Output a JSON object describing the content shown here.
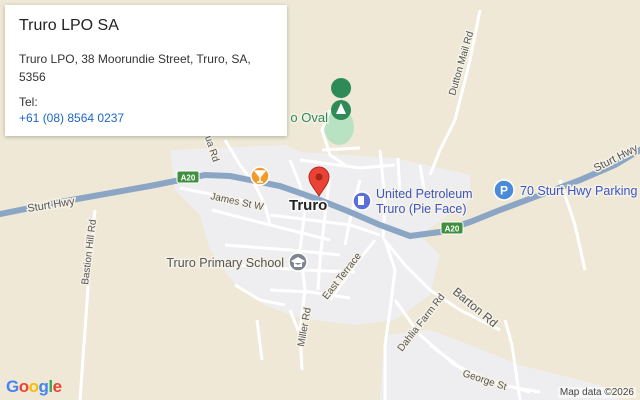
{
  "info_card": {
    "title": "Truro LPO SA",
    "address": "Truro LPO, 38 Moorundie Street, Truro, SA, 5356",
    "tel_label": "Tel:",
    "tel_value": "+61 (08) 8564 0237"
  },
  "map": {
    "town": "Truro",
    "pois": {
      "oval": "o Oval",
      "petrol_line1": "United Petroleum",
      "petrol_line2": "Truro (Pie Face)",
      "parking": "70 Sturt Hwy Parking",
      "parking_badge": "P",
      "school": "Truro Primary School"
    },
    "roads": {
      "sturt_west": "Sturt Hwy",
      "sturt_east": "Sturt Hwy",
      "james": "James St W",
      "bastion": "Bastion Hill Rd",
      "dutton": "Dutton Mail Rd",
      "east_terrace": "East Terrace",
      "miller": "Miller Rd",
      "barton": "Barton Rd",
      "dahlia": "Dahlia Farm Rd",
      "george": "George St",
      "rd_fragment": "ua Rd"
    },
    "shields": {
      "west": "A20",
      "east": "A20"
    },
    "colors": {
      "land": "#efe8d6",
      "town": "#eeeef0",
      "highway": "#8ba6c4",
      "park": "#b9e2c3",
      "pin": "#ea4335"
    }
  },
  "footer": {
    "logo": [
      "G",
      "o",
      "o",
      "g",
      "l",
      "e"
    ],
    "attribution": "Map data ©2026"
  }
}
